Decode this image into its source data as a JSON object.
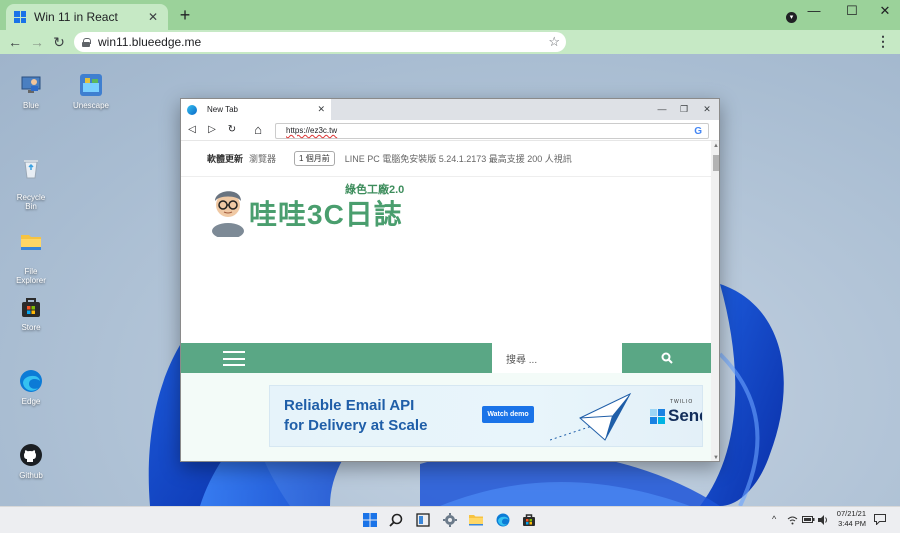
{
  "chrome": {
    "tab_title": "Win 11 in React",
    "tab_close": "✕",
    "new_tab": "+",
    "url": "win11.blueedge.me",
    "window_controls": {
      "minimize": "—",
      "maximize": "☐",
      "close": "✕"
    },
    "nav": {
      "back": "←",
      "forward": "→",
      "reload": "↻",
      "star": "☆",
      "menu": "⋮"
    },
    "profile_icon": "▾"
  },
  "desktop_icons": [
    {
      "label": "Blue",
      "icon": "user-computer-icon"
    },
    {
      "label": "Unescape",
      "icon": "unescape-app-icon"
    },
    {
      "label": "Recycle\nBin",
      "icon": "recycle-bin-icon"
    },
    {
      "label": "File\nExplorer",
      "icon": "folder-icon"
    },
    {
      "label": "Store",
      "icon": "store-bag-icon"
    },
    {
      "label": "Edge",
      "icon": "edge-icon"
    },
    {
      "label": "Github",
      "icon": "github-icon"
    }
  ],
  "inner_browser": {
    "tab_title": "New Tab",
    "tab_close": "✕",
    "window_controls": {
      "minimize": "—",
      "maximize": "❐",
      "close": "✕"
    },
    "nav": {
      "back": "◁",
      "forward": "▷",
      "reload": "↻",
      "home": "⌂"
    },
    "url": "https://ez3c.tw",
    "search_engine_icon": "G"
  },
  "site": {
    "news_label": "軟體更新",
    "news_site": "瀏覽器",
    "news_time": "1 個月前",
    "news_headline": "LINE PC 電腦免安裝版 5.24.1.2173 最高支援 200 人視訊",
    "brand_sub": "綠色工廠2.0",
    "brand_main": "哇哇3C日誌",
    "search_placeholder": "搜尋 ...",
    "brand_color": "#4a9e6e",
    "nav_color": "#5aa785"
  },
  "ad": {
    "title": "Reliable Email API\nfor Delivery at Scale",
    "cta": "Watch demo",
    "brand_small": "TWILIO",
    "brand": "Send"
  },
  "taskbar": {
    "icons": [
      "windows-start-icon",
      "search-icon",
      "task-view-icon",
      "settings-icon",
      "file-explorer-icon",
      "edge-icon",
      "store-icon"
    ],
    "tray": {
      "chevron": "^",
      "wifi": "wifi-icon",
      "battery": "battery-icon",
      "volume": "volume-icon",
      "notification": "notification-icon"
    },
    "date": "07/21/21",
    "time": "3:44 PM"
  }
}
